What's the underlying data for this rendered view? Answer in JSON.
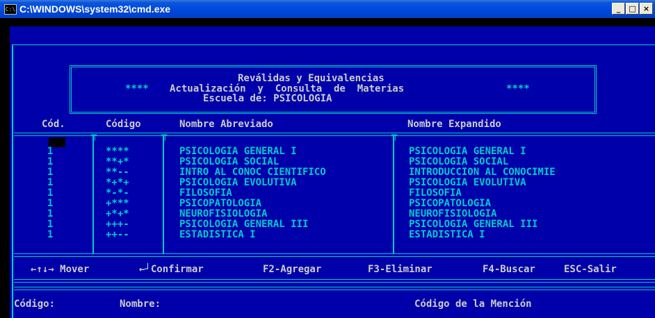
{
  "window": {
    "title": "C:\\WINDOWS\\system32\\cmd.exe",
    "icon_glyph": "C:\\",
    "buttons": [
      "_",
      "□",
      "×"
    ]
  },
  "header": {
    "line1": "Reválidas y Equivalencias",
    "line2_stars": "****",
    "line2": "Actualización  y  Consulta  de  Materias",
    "line3": "Escuela de: PSICOLOGIA"
  },
  "table": {
    "columns": [
      "Cód.",
      "Código",
      "Nombre Abreviado",
      "Nombre Expandido"
    ],
    "rows": [
      {
        "cod": "1",
        "codigo": "****",
        "abrev": "PSICOLOGIA GENERAL I",
        "exp": "PSICOLOGIA GENERAL I"
      },
      {
        "cod": "1",
        "codigo": "**+*",
        "abrev": "PSICOLOGIA SOCIAL",
        "exp": "PSICOLOGIA SOCIAL"
      },
      {
        "cod": "1",
        "codigo": "**--",
        "abrev": "INTRO AL CONOC CIENTIFICO",
        "exp": "INTRODUCCION AL CONOCIMIE"
      },
      {
        "cod": "1",
        "codigo": "*+*+",
        "abrev": "PSICOLOGIA EVOLUTIVA",
        "exp": "PSICOLOGIA EVOLUTIVA"
      },
      {
        "cod": "1",
        "codigo": "*-*-",
        "abrev": "FILOSOFIA",
        "exp": "FILOSOFIA"
      },
      {
        "cod": "1",
        "codigo": "+***",
        "abrev": "PSICOPATOLOGIA",
        "exp": "PSICOPATOLOGIA"
      },
      {
        "cod": "1",
        "codigo": "+*+*",
        "abrev": "NEUROFISIOLOGIA",
        "exp": "NEUROFISIOLOGIA"
      },
      {
        "cod": "1",
        "codigo": "+++-",
        "abrev": "PSICOLOGIA GENERAL III",
        "exp": "PSICOLOGIA GENERAL III"
      },
      {
        "cod": "1",
        "codigo": "++--",
        "abrev": "ESTADISTICA I",
        "exp": "ESTADISTICA I"
      }
    ]
  },
  "footer": {
    "mover": "←↑↓→ Mover",
    "confirmar": "←┘Confirmar",
    "agregar": "F2-Agregar",
    "eliminar": "F3-Eliminar",
    "buscar": "F4-Buscar",
    "salir": "ESC-Salir"
  },
  "status": {
    "codigo": "Código:",
    "nombre": "Nombre:",
    "mencion": "Código de la Mención"
  }
}
